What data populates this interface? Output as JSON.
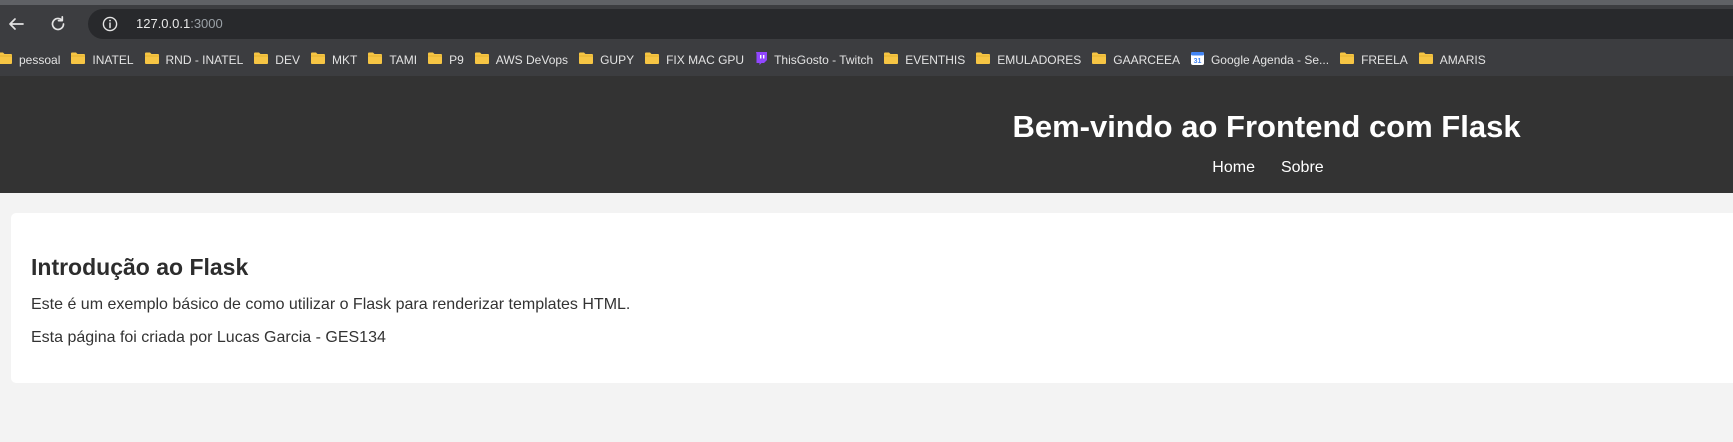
{
  "browser": {
    "url_host": "127.0.0.1",
    "url_port": ":3000",
    "bookmarks": [
      {
        "label": "pessoal",
        "icon": "folder-icon"
      },
      {
        "label": "INATEL",
        "icon": "folder-icon"
      },
      {
        "label": "RND - INATEL",
        "icon": "folder-icon"
      },
      {
        "label": "DEV",
        "icon": "folder-icon"
      },
      {
        "label": "MKT",
        "icon": "folder-icon"
      },
      {
        "label": "TAMI",
        "icon": "folder-icon"
      },
      {
        "label": "P9",
        "icon": "folder-icon"
      },
      {
        "label": "AWS DeVops",
        "icon": "folder-icon"
      },
      {
        "label": "GUPY",
        "icon": "folder-icon"
      },
      {
        "label": "FIX MAC GPU",
        "icon": "folder-icon"
      },
      {
        "label": "ThisGosto - Twitch",
        "icon": "twitch-icon"
      },
      {
        "label": "EVENTHIS",
        "icon": "folder-icon"
      },
      {
        "label": "EMULADORES",
        "icon": "folder-icon"
      },
      {
        "label": "GAARCEEA",
        "icon": "folder-icon"
      },
      {
        "label": "Google Agenda - Se...",
        "icon": "google-calendar-icon"
      },
      {
        "label": "FREELA",
        "icon": "folder-icon"
      },
      {
        "label": "AMARIS",
        "icon": "folder-icon"
      }
    ]
  },
  "header": {
    "title": "Bem-vindo ao Frontend com Flask",
    "nav": {
      "home_label": "Home",
      "about_label": "Sobre"
    }
  },
  "main": {
    "heading": "Introdução ao Flask",
    "paragraph_1": "Este é um exemplo básico de como utilizar o Flask para renderizar templates HTML.",
    "paragraph_2": "Esta página foi criada por Lucas Garcia - GES134"
  },
  "colors": {
    "header_bg": "#333333",
    "page_bg": "#f3f3f3",
    "card_bg": "#ffffff",
    "folder": "#f6c544",
    "twitch": "#9146ff",
    "calendar": "#4285f4"
  }
}
